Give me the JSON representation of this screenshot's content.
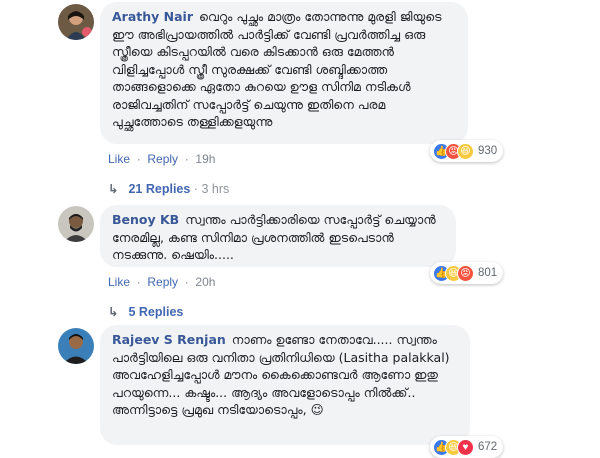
{
  "comments": [
    {
      "author": "Arathy Nair",
      "text": "വെറും പുച്ഛം മാത്രം തോന്നുന്നു മുരളി ജിയുടെ ഈ അഭിപ്രായത്തിൽ പാർട്ടിക്ക് വേണ്ടി പ്രവർത്തിച്ച ഒരു സ്ത്രീയെ കിടപ്പറയിൽ വരെ കിടക്കാൻ ഒരു മേത്തൻ വിളിച്ചപ്പോൾ സ്ത്രീ സുരക്ഷക്ക് വേണ്ടി ശബ്ദിക്കാത്ത താങ്ങളൊക്കെ ഏതോ കുറയെ ഊള സിനിമ നടികൾ രാജിവച്ചതിന് സപ്പോർട്ട് ചെയുന്നു ഇതിനെ പരമ പുച്ഛത്തോടെ തള്ളിക്കളയുന്നു",
      "like": "Like",
      "reply": "Reply",
      "time": "19h",
      "reaction_count": "930",
      "replies_label": "21 Replies",
      "replies_time": "3 hrs"
    },
    {
      "author": "Benoy KB",
      "text": "സ്വന്തം പാർട്ടിക്കാരിയെ സപ്പോർട്ട് ചെയ്യാൻ നേരമില്ല, കണ്ട സിനിമാ പ്രശനത്തിൽ ഇടപെടാൻ നടക്കുന്നു. ഷെയിം.....",
      "like": "Like",
      "reply": "Reply",
      "time": "20h",
      "reaction_count": "801",
      "replies_label": "5 Replies"
    },
    {
      "author": "Rajeev S Renjan",
      "text": "നാണം ഉണ്ടോ നേതാവേ..... സ്വന്തം പാർട്ടിയിലെ ഒരു വനിതാ പ്രതിനിധിയെ (Lasitha palakkal) അവഹേളിച്ചപ്പോൾ മൗനം കൈക്കൊണ്ടവർ ആണോ ഇതു പറയുന്നെ... കഷ്ടം... ആദ്യം അവളോടൊപ്പം നിൽക്ക്.. അന്നിട്ടാട്ടെ പ്രമുഖ നടിയോടൊപ്പം,",
      "emoji": "😉",
      "reaction_count": "672"
    }
  ],
  "colors": {
    "link": "#4267b2",
    "name": "#385898",
    "bubble": "#f2f3f5",
    "like_reaction": "#3b79f0",
    "angry_reaction": "#f5533d",
    "haha_reaction": "#f7c93e"
  }
}
